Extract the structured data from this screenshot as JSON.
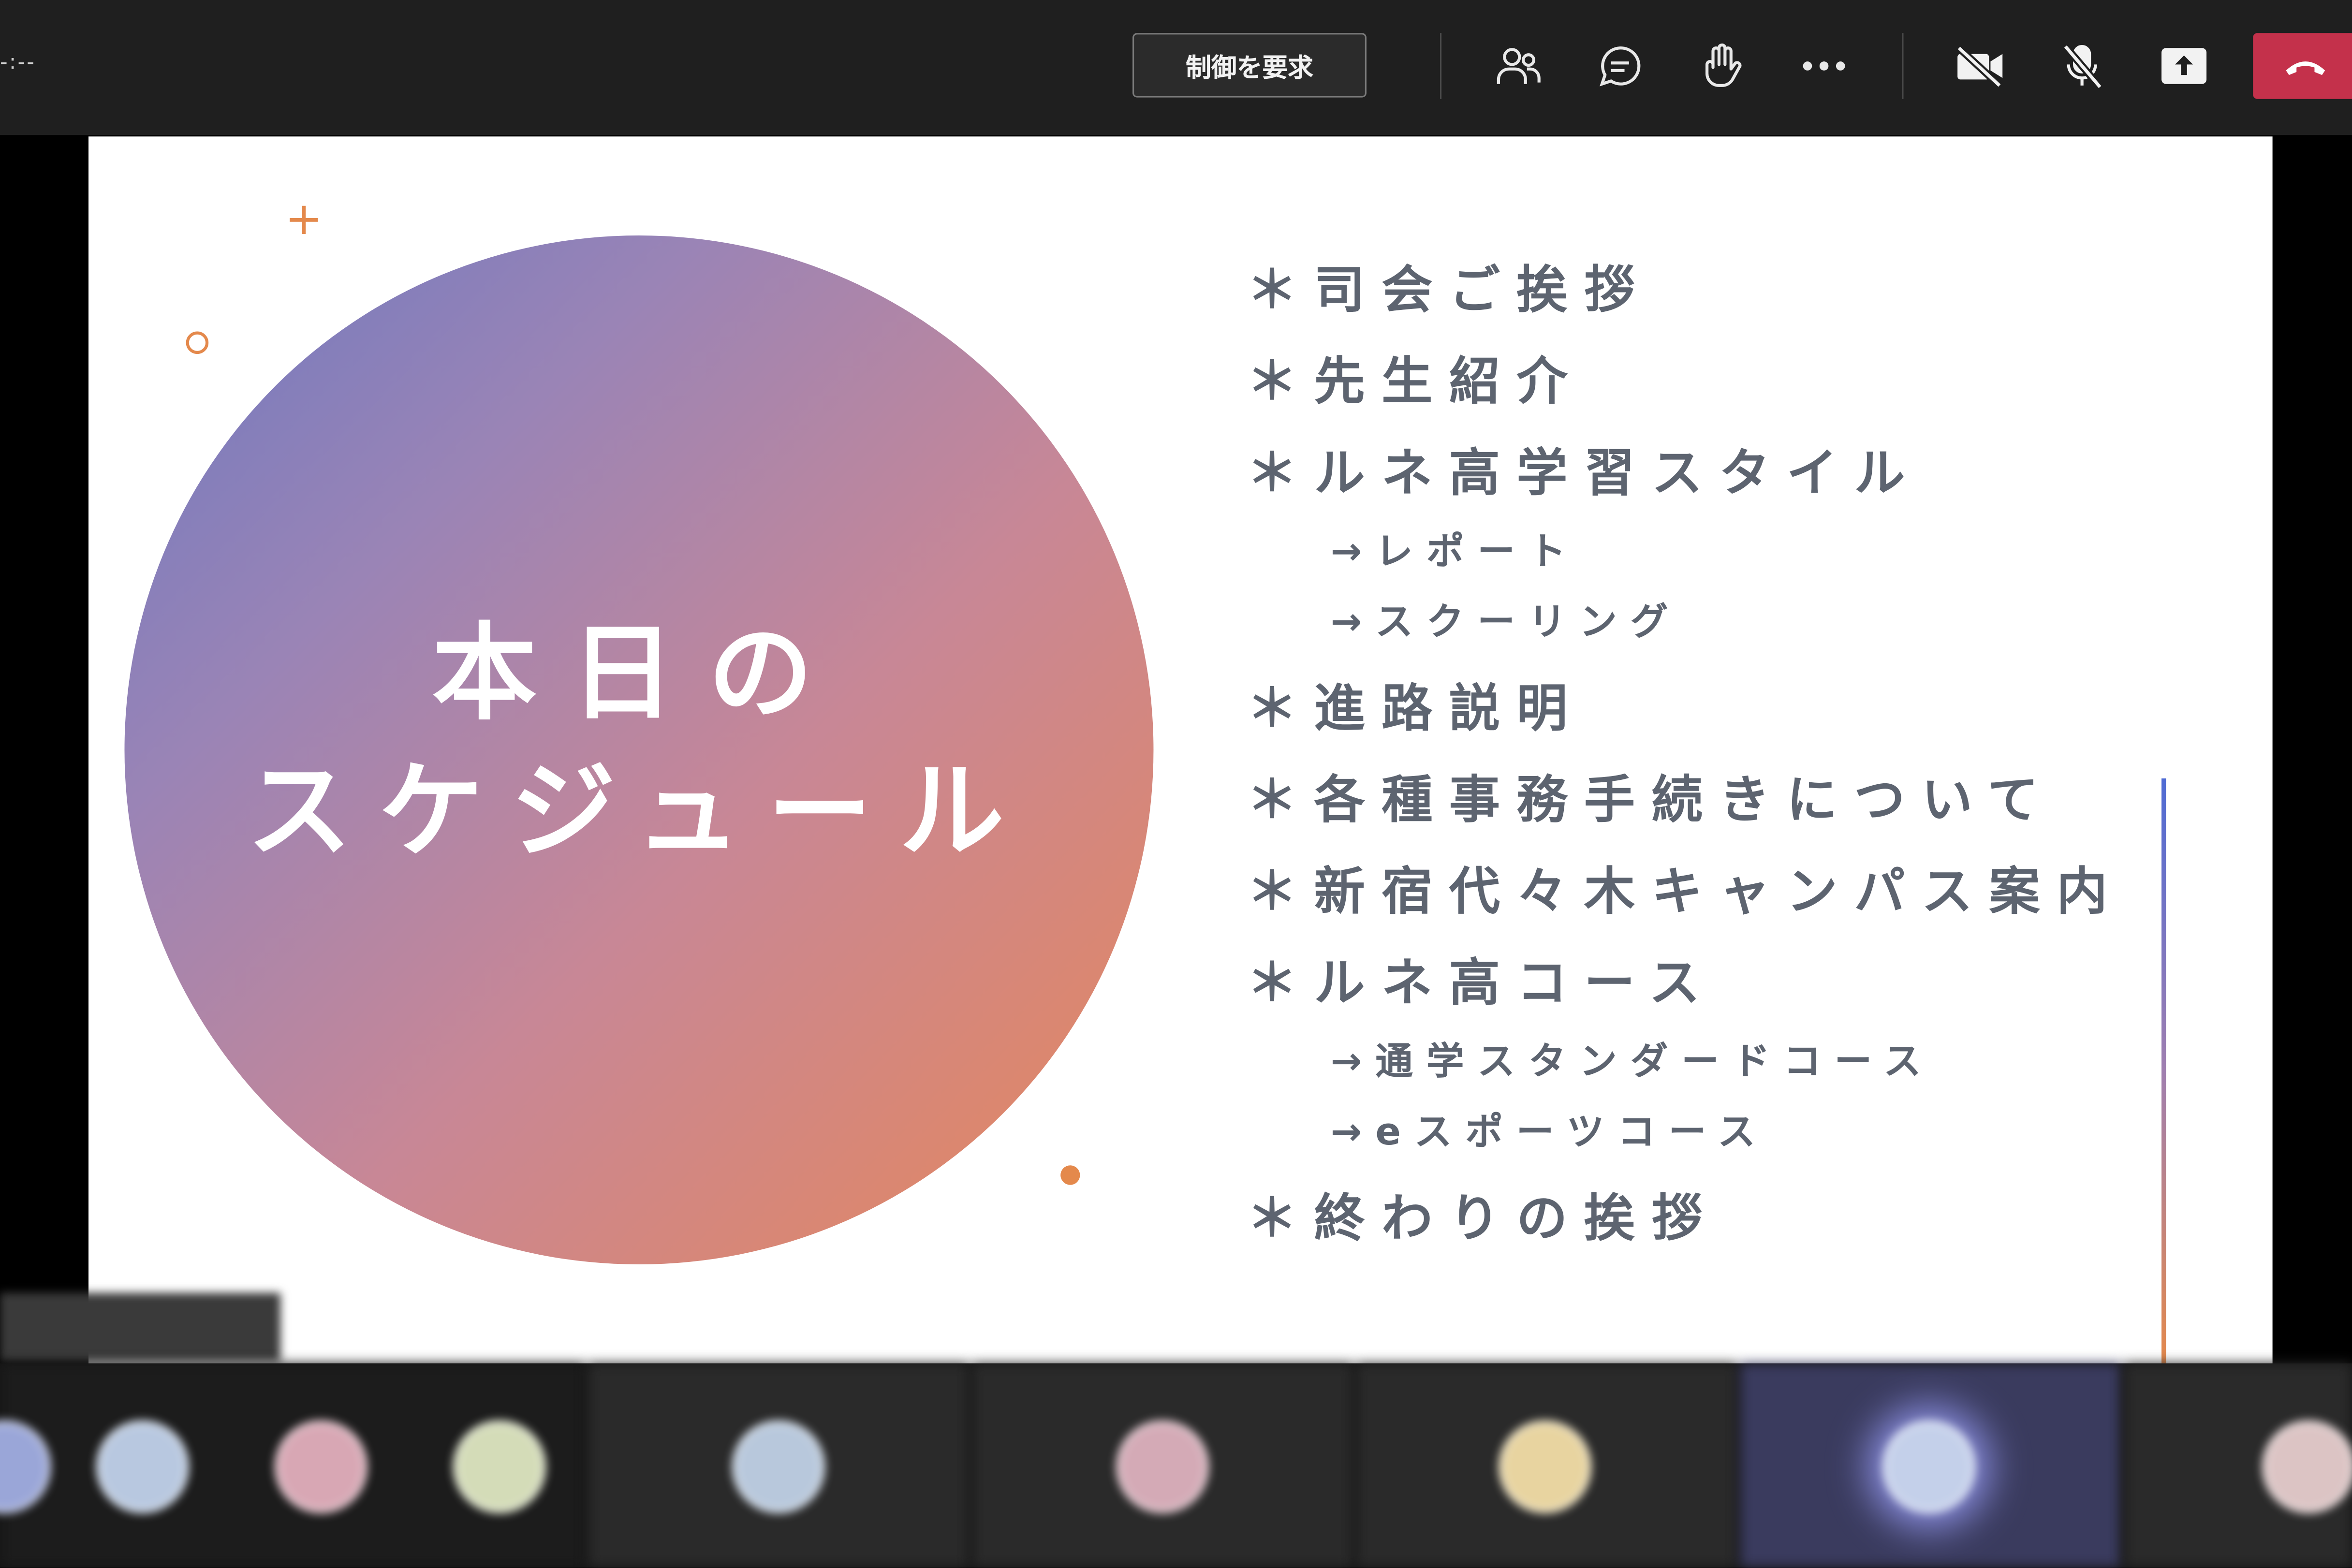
{
  "toolbar": {
    "timer": "-:--",
    "request_control_label": "制御を要求",
    "icons": [
      "participants-icon",
      "chat-icon",
      "raise-hand-icon",
      "more-icon",
      "camera-off-icon",
      "mic-off-icon",
      "share-icon",
      "hang-up-icon"
    ],
    "hangup_color": "#c4314b"
  },
  "slide": {
    "title_line1": "本日の",
    "title_line2": "スケジュール",
    "agenda": [
      "＊司会ご挨拶",
      "＊先生紹介",
      "＊ルネ高学習スタイル",
      "→レポート",
      "→スクーリング",
      "＊進路説明",
      "＊各種事務手続きについて",
      "＊新宿代々木キャンパス案内",
      "＊ルネ高コース",
      "→通学スタンダードコース",
      "→eスポーツコース",
      "＊終わりの挨拶"
    ],
    "decor_plus": "+",
    "colors": {
      "accent_orange": "#e4894c",
      "text_gray": "#5d6470",
      "gradient_start": "#6c78c0",
      "gradient_end": "#e6875a"
    }
  }
}
